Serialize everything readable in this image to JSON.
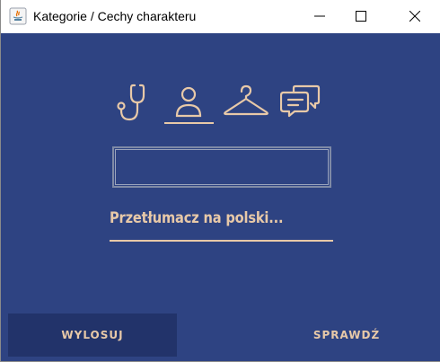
{
  "window": {
    "title": "Kategorie / Cechy charakteru",
    "controls": [
      "minimize",
      "maximize",
      "close"
    ]
  },
  "categories": [
    {
      "icon": "stethoscope-icon",
      "selected": false
    },
    {
      "icon": "person-icon",
      "selected": true
    },
    {
      "icon": "hanger-icon",
      "selected": false
    },
    {
      "icon": "chat-bubbles-icon",
      "selected": false
    }
  ],
  "answer": {
    "value": "",
    "prompt": "Przetłumacz na polski..."
  },
  "buttons": {
    "draw_label": "WYLOSUJ",
    "check_label": "SPRAWDŹ"
  },
  "colors": {
    "background": "#2e4382",
    "accent": "#e8c9a8",
    "button_dark": "#22336a"
  }
}
